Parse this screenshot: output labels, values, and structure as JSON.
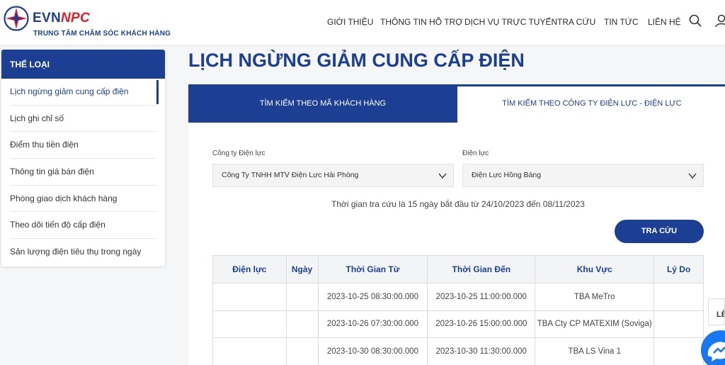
{
  "brand": {
    "name_part1": "EVN",
    "name_part2": "NPC",
    "subtitle": "TRUNG TÂM CHĂM SÓC KHÁCH HÀNG"
  },
  "nav": [
    {
      "label": "GIỚI THIỆU"
    },
    {
      "label": "THÔNG TIN HỖ TRỢ"
    },
    {
      "label": "DỊCH VỤ TRỰC TUYẾN"
    },
    {
      "label": "TRA CỨU"
    },
    {
      "label": "TIN TỨC"
    },
    {
      "label": "LIÊN HỆ"
    }
  ],
  "sidebar": {
    "title": "THỂ LOẠI",
    "items": [
      {
        "label": "Lịch ngừng giảm cung cấp điện",
        "active": true
      },
      {
        "label": "Lịch ghi chỉ số"
      },
      {
        "label": "Điểm thu tiền điện"
      },
      {
        "label": "Thông tin giá bán điện"
      },
      {
        "label": "Phòng giao dịch khách hàng"
      },
      {
        "label": "Theo dõi tiến độ cấp điện"
      },
      {
        "label": "Sản lượng điện tiêu thụ trong ngày"
      }
    ]
  },
  "page_title": "LỊCH NGỪNG GIẢM CUNG CẤP ĐIỆN",
  "tabs": [
    {
      "label": "TÌM KIẾM THEO MÃ KHÁCH HÀNG",
      "active": true
    },
    {
      "label": "TÌM KIẾM THEO CÔNG TY ĐIỆN LỰC - ĐIỆN LỰC"
    }
  ],
  "form": {
    "company_label": "Công ty Điện lực",
    "company_value": "Công Ty TNHH MTV Điện Lực Hải Phòng",
    "unit_label": "Điện lực",
    "unit_value": "Điện Lực Hồng Bàng",
    "note": "Thời gian tra cứu là 15 ngày bắt đầu từ 24/10/2023 đến 08/11/2023",
    "search_button": "TRA CỨU"
  },
  "table": {
    "headers": [
      "Điện lực",
      "Ngày",
      "Thời Gian Từ",
      "Thời Gian Đến",
      "Khu Vực",
      "Lý Do"
    ],
    "rows": [
      [
        "",
        "",
        "2023-10-25 08:30:00.000",
        "2023-10-25 11:00:00.000",
        "TBA MeTro",
        ""
      ],
      [
        "",
        "",
        "2023-10-26 07:30:00.000",
        "2023-10-26 15:00:00.000",
        "TBA Cty CP MATEXIM (Soviga)",
        ""
      ],
      [
        "",
        "",
        "2023-10-30 08:30:00.000",
        "2023-10-30 11:30:00.000",
        "TBA LS Vina 1",
        ""
      ]
    ]
  },
  "back_top": "LÊ",
  "colors": {
    "primary": "#1c3f94",
    "accent": "#e31e24",
    "messenger": "#1877f2"
  },
  "icons": [
    "evn-logo-icon",
    "search-icon",
    "user-icon",
    "chevron-down-icon",
    "messenger-icon"
  ]
}
